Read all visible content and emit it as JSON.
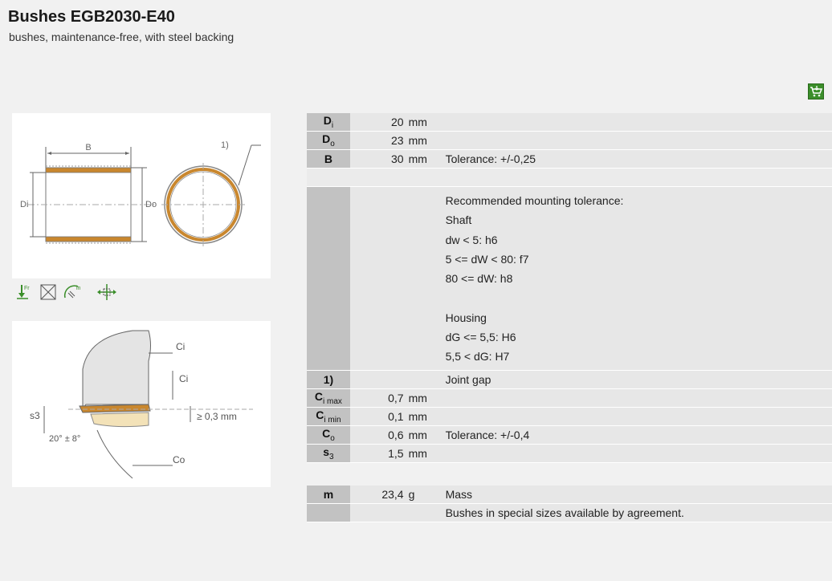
{
  "header": {
    "title": "Bushes EGB2030-E40",
    "subtitle": "bushes, maintenance-free, with steel backing"
  },
  "cart_icon": "cart-icon",
  "drawing1": {
    "labels": {
      "b": "B",
      "di": "Di",
      "do": "Do",
      "note": "1)"
    }
  },
  "drawing2": {
    "labels": {
      "ci_top": "Ci",
      "ci_mid": "Ci",
      "s3": "s3",
      "angle": "20° ± 8°",
      "gap": "≥ 0,3 mm",
      "co": "Co"
    }
  },
  "spec": {
    "rows": [
      {
        "sym": "D",
        "sub": "i",
        "value": "20",
        "unit": "mm",
        "desc": ""
      },
      {
        "sym": "D",
        "sub": "o",
        "value": "23",
        "unit": "mm",
        "desc": ""
      },
      {
        "sym": "B",
        "sub": "",
        "value": "30",
        "unit": "mm",
        "desc": "Tolerance: +/-0,25"
      }
    ],
    "mounting": {
      "lines": [
        "Recommended mounting tolerance:",
        "Shaft",
        "dw < 5: h6",
        "5 <= dW < 80: f7",
        "80 <= dW: h8",
        "",
        "Housing",
        "dG <= 5,5: H6",
        "5,5 < dG: H7"
      ]
    },
    "joint": {
      "sym": "1)",
      "desc": "Joint gap"
    },
    "rows2": [
      {
        "sym": "C",
        "sub": "i max",
        "value": "0,7",
        "unit": "mm",
        "desc": ""
      },
      {
        "sym": "C",
        "sub": "i min",
        "value": "0,1",
        "unit": "mm",
        "desc": ""
      },
      {
        "sym": "C",
        "sub": "o",
        "value": "0,6",
        "unit": "mm",
        "desc": "Tolerance: +/-0,4"
      },
      {
        "sym": "s",
        "sub": "3",
        "value": "1,5",
        "unit": "mm",
        "desc": ""
      }
    ],
    "mass": {
      "sym": "m",
      "value": "23,4",
      "unit": "g",
      "desc": "Mass"
    },
    "note": "Bushes in special sizes available by agreement."
  }
}
